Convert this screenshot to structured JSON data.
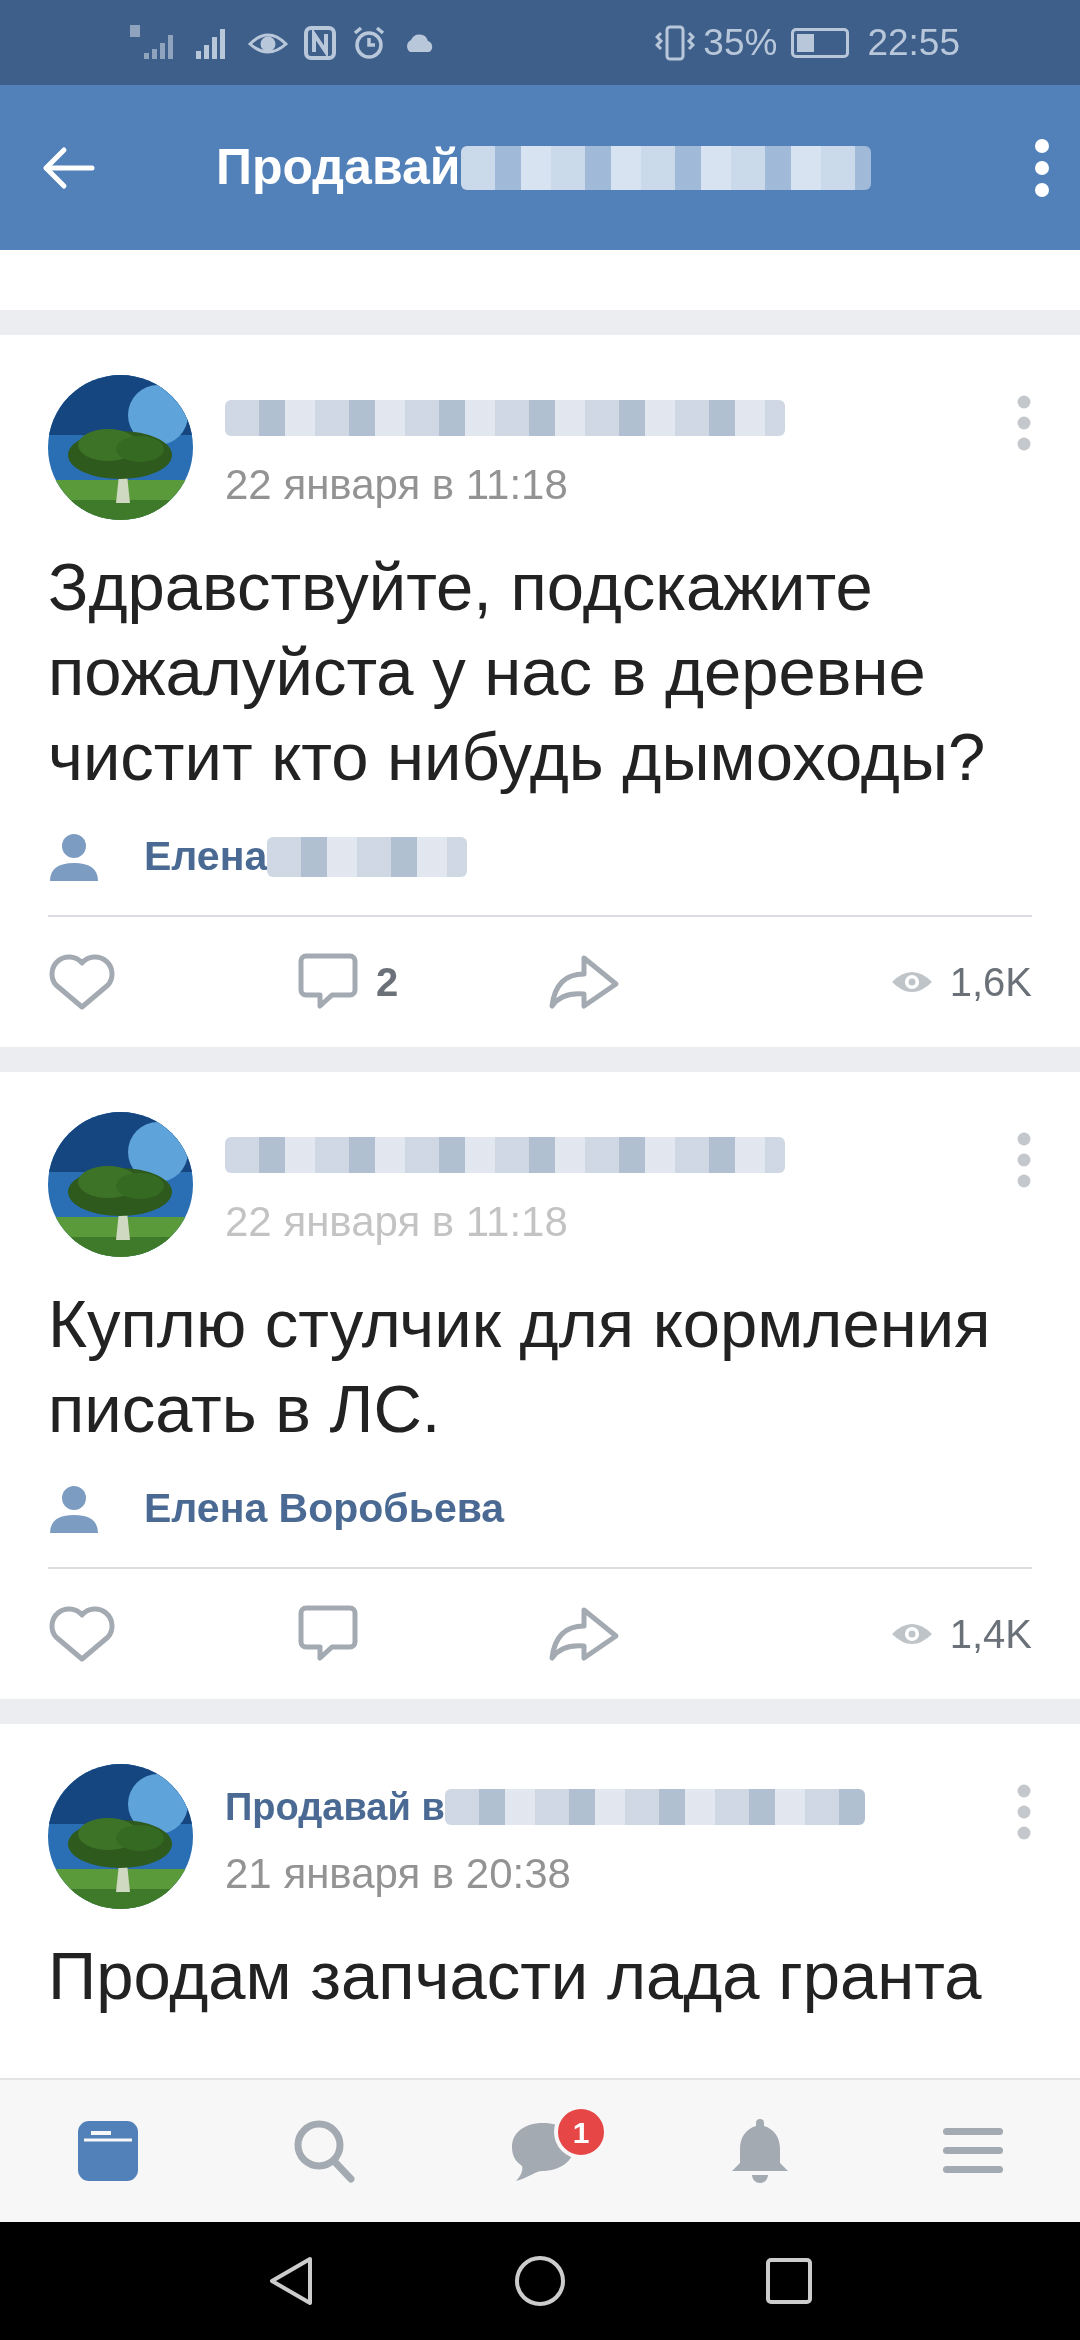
{
  "status_bar": {
    "battery": "35%",
    "time": "22:55"
  },
  "header": {
    "title": "Продавай",
    "title_blurred": true
  },
  "posts": [
    {
      "author_blurred": true,
      "date": "22 января в 11:18",
      "text": "Здравствуйте, подскажите пожалуйста у нас в деревне чистит кто нибудь дымоходы?",
      "signer": "Елена",
      "signer_blurred": true,
      "liked": false,
      "comments": "2",
      "views": "1,6K"
    },
    {
      "author_blurred": true,
      "date_blurred": true,
      "date": "22 января в 11:18",
      "text": "Куплю стулчик для кормления писать в ЛС.",
      "signer": "Елена Воробьева",
      "signer_blurred": false,
      "liked": false,
      "views": "1,4K"
    },
    {
      "author": "Продавай в",
      "author_blurred": true,
      "date": "21 января в 20:38",
      "text": "Продам запчасти лада гранта"
    }
  ],
  "bottom_nav": [
    {
      "kind": "news",
      "selected": true
    },
    {
      "kind": "search",
      "selected": false
    },
    {
      "kind": "messages",
      "selected": false,
      "badge": "1"
    },
    {
      "kind": "notifications",
      "selected": false
    },
    {
      "kind": "menu",
      "selected": false
    }
  ]
}
